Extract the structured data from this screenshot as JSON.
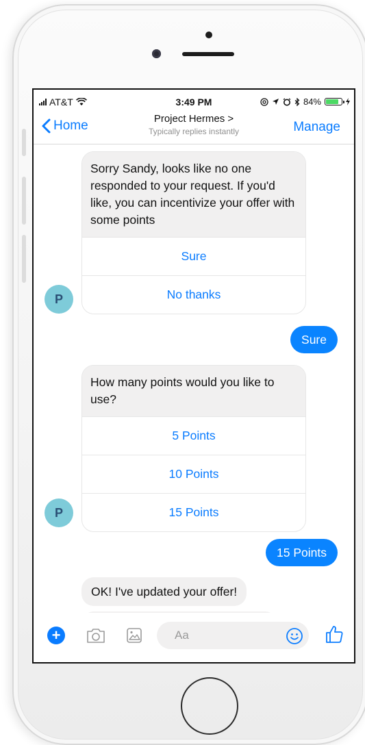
{
  "status_bar": {
    "carrier": "AT&T",
    "time": "3:49 PM",
    "battery_percent": "84%",
    "battery_level": 0.84,
    "icons": [
      "signal-bars-icon",
      "wifi-icon",
      "at-sign-icon",
      "location-arrow-icon",
      "alarm-icon",
      "bluetooth-icon",
      "battery-icon",
      "charging-bolt-icon"
    ]
  },
  "header": {
    "back_label": "Home",
    "title": "Project Hermes >",
    "subtitle": "Typically replies instantly",
    "manage_label": "Manage"
  },
  "messages": [
    {
      "type": "incoming_card",
      "text": "Sorry Sandy, looks like no one responded to your request. If you'd like, you can incentivize your offer with some points",
      "options": [
        "Sure",
        "No thanks"
      ],
      "avatar": "P"
    },
    {
      "type": "outgoing",
      "text": "Sure"
    },
    {
      "type": "incoming_card",
      "text": "How many points would you like to use?",
      "options": [
        "5 Points",
        "10 Points",
        "15 Points"
      ],
      "avatar": "P"
    },
    {
      "type": "outgoing",
      "text": "15 Points"
    },
    {
      "type": "incoming",
      "text": "OK! I've updated your offer!"
    }
  ],
  "composer": {
    "placeholder": "Aa",
    "icons": [
      "plus-icon",
      "camera-icon",
      "image-icon",
      "emoji-icon",
      "thumbs-up-icon"
    ]
  },
  "colors": {
    "accent": "#0a7cff",
    "outgoing_bubble": "#0a84ff",
    "incoming_bubble": "#f1f0f0",
    "avatar_bg": "#7ecbd9",
    "avatar_text": "#2a4e74",
    "battery_fill": "#4cd964"
  }
}
